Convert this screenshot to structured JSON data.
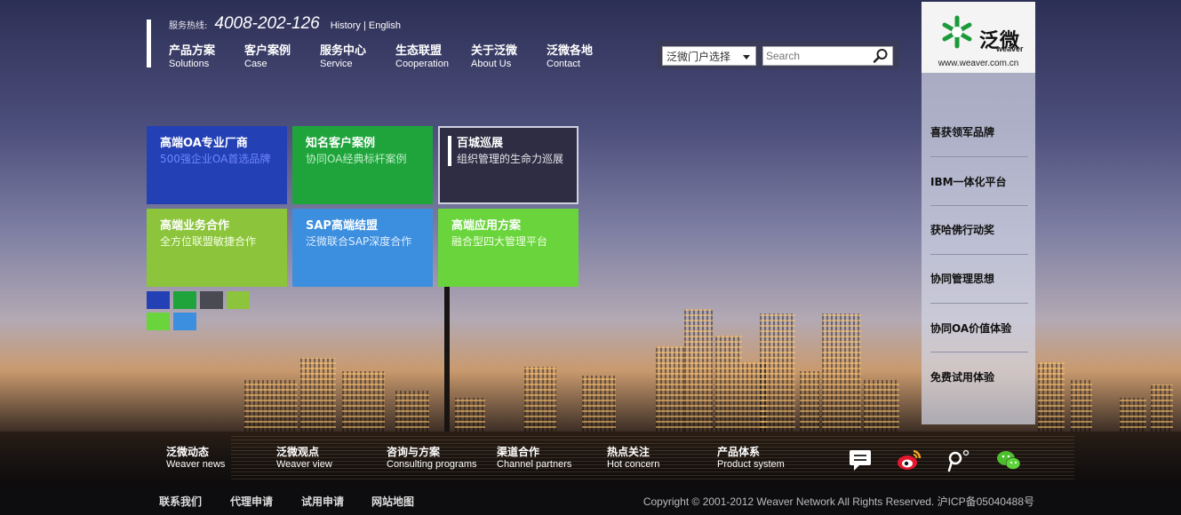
{
  "header": {
    "hotline_label": "服务热线:",
    "hotline_number": "4008-202-126",
    "links": "History | English"
  },
  "nav": [
    {
      "cn": "产品方案",
      "en": "Solutions"
    },
    {
      "cn": "客户案例",
      "en": "Case"
    },
    {
      "cn": "服务中心",
      "en": "Service"
    },
    {
      "cn": "生态联盟",
      "en": "Cooperation"
    },
    {
      "cn": "关于泛微",
      "en": "About Us"
    },
    {
      "cn": "泛微各地",
      "en": "Contact"
    }
  ],
  "search": {
    "portal_select": "泛微门户选择",
    "placeholder": "Search"
  },
  "logo": {
    "cn": "泛微",
    "en": "weaver",
    "url": "www.weaver.com.cn"
  },
  "side_links": [
    "喜获领军品牌",
    "IBM一体化平台",
    "获哈佛行动奖",
    "协同管理思想",
    "协同OA价值体验",
    "免费试用体验"
  ],
  "tiles": [
    {
      "title": "高端OA专业厂商",
      "subtitle": "500强企业OA首选品牌",
      "color": "#2440b5",
      "subcolor": "#6f86ff"
    },
    {
      "title": "知名客户案例",
      "subtitle": "协同OA经典标杆案例",
      "color": "#1fa43c",
      "subcolor": "#bfeec8"
    },
    {
      "title": "百城巡展",
      "subtitle": "组织管理的生命力巡展",
      "color": "#2e2d43",
      "subcolor": "#e6e6ee"
    },
    {
      "title": "高端业务合作",
      "subtitle": "全方位联盟敏捷合作",
      "color": "#8cc43c",
      "subcolor": "#f3ffe0"
    },
    {
      "title": "SAP高端结盟",
      "subtitle": "泛微联合SAP深度合作",
      "color": "#3c8ede",
      "subcolor": "#e1efff"
    },
    {
      "title": "高端应用方案",
      "subtitle": "融合型四大管理平台",
      "color": "#6ad43c",
      "subcolor": "#f0ffe5"
    }
  ],
  "tile_dot_colors": [
    "#2440b5",
    "#1fa43c",
    "#4a4a52",
    "#8cc43c",
    "#6ad43c",
    "#3c8ede"
  ],
  "bottom_nav": [
    {
      "cn": "泛微动态",
      "en": "Weaver news"
    },
    {
      "cn": "泛微观点",
      "en": "Weaver view"
    },
    {
      "cn": "咨询与方案",
      "en": "Consulting programs"
    },
    {
      "cn": "渠道合作",
      "en": "Channel partners"
    },
    {
      "cn": "热点关注",
      "en": "Hot concern"
    },
    {
      "cn": "产品体系",
      "en": "Product system"
    }
  ],
  "social_icons": [
    "message-icon",
    "weibo-icon",
    "tencent-weibo-icon",
    "wechat-icon"
  ],
  "footer": {
    "links": [
      "联系我们",
      "代理申请",
      "试用申请",
      "网站地图"
    ],
    "copyright": "Copyright © 2001-2012 Weaver Network All Rights Reserved. 沪ICP备05040488号"
  }
}
